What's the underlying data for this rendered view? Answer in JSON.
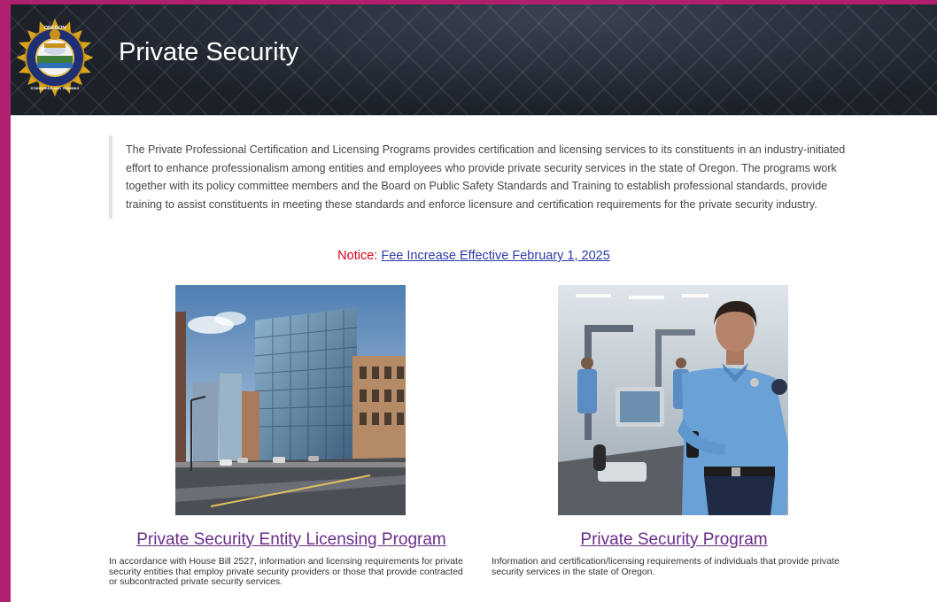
{
  "header": {
    "title": "Private Security",
    "seal": {
      "top_text": "OREGON",
      "ring_text": "DEPARTMENT OF PUBLIC SAFETY",
      "bottom_text": "STANDARDS AND TRAINING"
    }
  },
  "intro": {
    "text": "The Private Professional Certification and Licensing Programs provides certification and licensing services to its constituents in an industry-initiated effort to enhance professionalism among entities and employees who provide private security services in the state of Oregon. The programs work together with its policy committee members and the Board on Public Safety Standards and Training to establish professional standards, provide training to assist constituents in meeting these standards and enforce licensure and certification requirements for the private security industry."
  },
  "notice": {
    "label": "Notice:",
    "link_text": "Fee Increase Effective February 1, 2025"
  },
  "cards": [
    {
      "title": "Private Security Entity Licensing Program",
      "description": "In accordance with House Bill 2527, information and licensing requirements for private security entities that employ private security providers or those that provide contracted or subcontracted private security services."
    },
    {
      "title": "Private Security Program",
      "description": "Information and certification/licensing requirements of individuals that provide private security services in the state of Oregon."
    }
  ],
  "colors": {
    "page_border": "#b1206f",
    "banner": "#1b2029",
    "notice_label": "#d9001b",
    "link": "#2b3ba8",
    "card_link": "#6a2c89"
  }
}
